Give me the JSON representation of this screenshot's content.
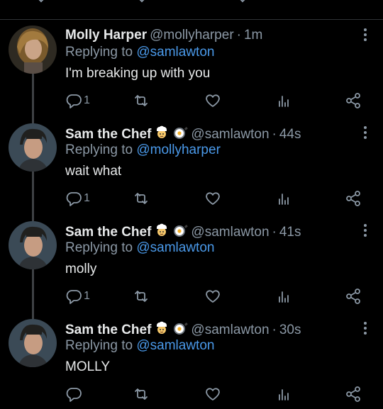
{
  "tweets": [
    {
      "name": "Molly Harper",
      "handle": "@mollyharper",
      "time": "1m",
      "replying_prefix": "Replying to",
      "replying_to": "@samlawton",
      "text": "I'm breaking up with you",
      "reply_count": "1",
      "has_emoji": false
    },
    {
      "name": "Sam the Chef",
      "handle": "@samlawton",
      "time": "44s",
      "replying_prefix": "Replying to",
      "replying_to": "@mollyharper",
      "text": "wait what",
      "reply_count": "1",
      "has_emoji": true
    },
    {
      "name": "Sam the Chef",
      "handle": "@samlawton",
      "time": "41s",
      "replying_prefix": "Replying to",
      "replying_to": "@samlawton",
      "text": "molly",
      "reply_count": "1",
      "has_emoji": true
    },
    {
      "name": "Sam the Chef",
      "handle": "@samlawton",
      "time": "30s",
      "replying_prefix": "Replying to",
      "replying_to": "@samlawton",
      "text": "MOLLY",
      "reply_count": "",
      "has_emoji": true
    }
  ],
  "colors": {
    "background": "#000000",
    "text": "#e7e9ea",
    "muted": "#8b98a5",
    "link": "#4a99e9",
    "thread_line": "#3e4144"
  },
  "icons": [
    "reply-icon",
    "retweet-icon",
    "like-icon",
    "analytics-icon",
    "share-icon",
    "more-icon",
    "chef-emoji",
    "frying-pan-emoji"
  ]
}
